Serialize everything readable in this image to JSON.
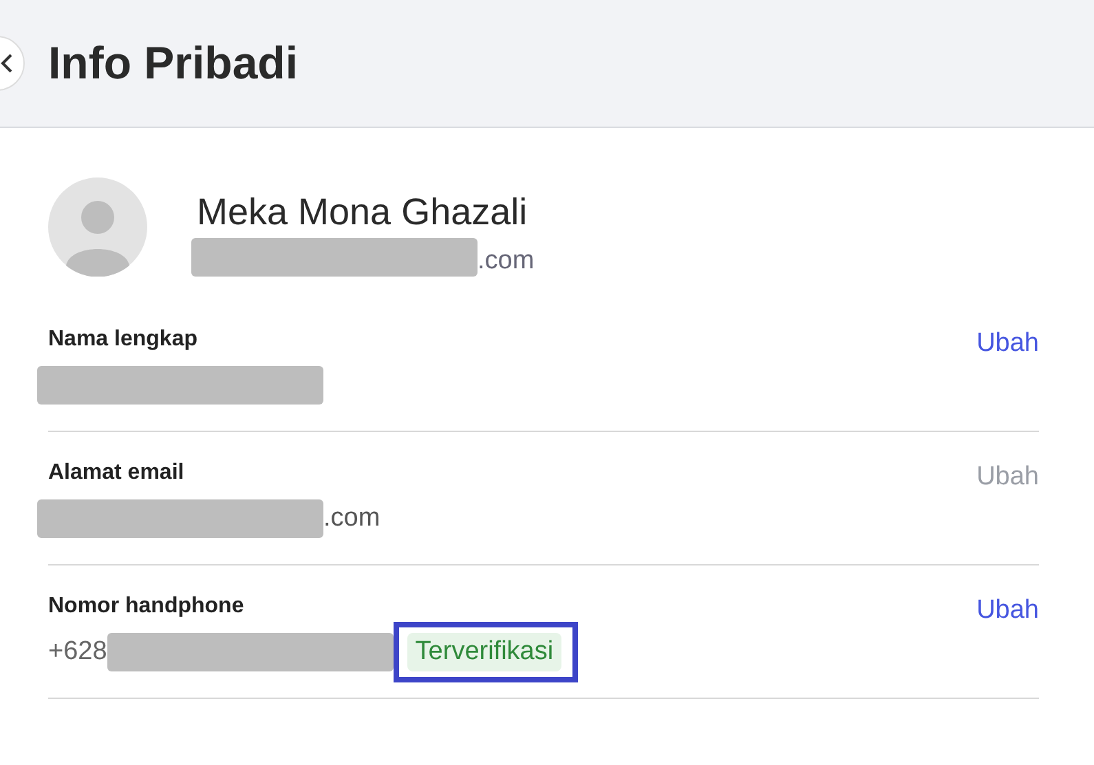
{
  "header": {
    "title": "Info Pribadi"
  },
  "profile": {
    "name": "Meka Mona Ghazali",
    "email_redacted": true,
    "email_suffix": ".com"
  },
  "fields": [
    {
      "label": "Nama lengkap",
      "redacted": true,
      "action": {
        "label": "Ubah",
        "disabled": false
      }
    },
    {
      "label": "Alamat email",
      "redacted": true,
      "suffix": ".com",
      "action": {
        "label": "Ubah",
        "disabled": true
      }
    },
    {
      "label": "Nomor handphone",
      "prefix": "+628",
      "redacted": true,
      "action": {
        "label": "Ubah",
        "disabled": false
      },
      "badge": {
        "label": "Terverifikasi",
        "highlighted": true
      }
    }
  ]
}
